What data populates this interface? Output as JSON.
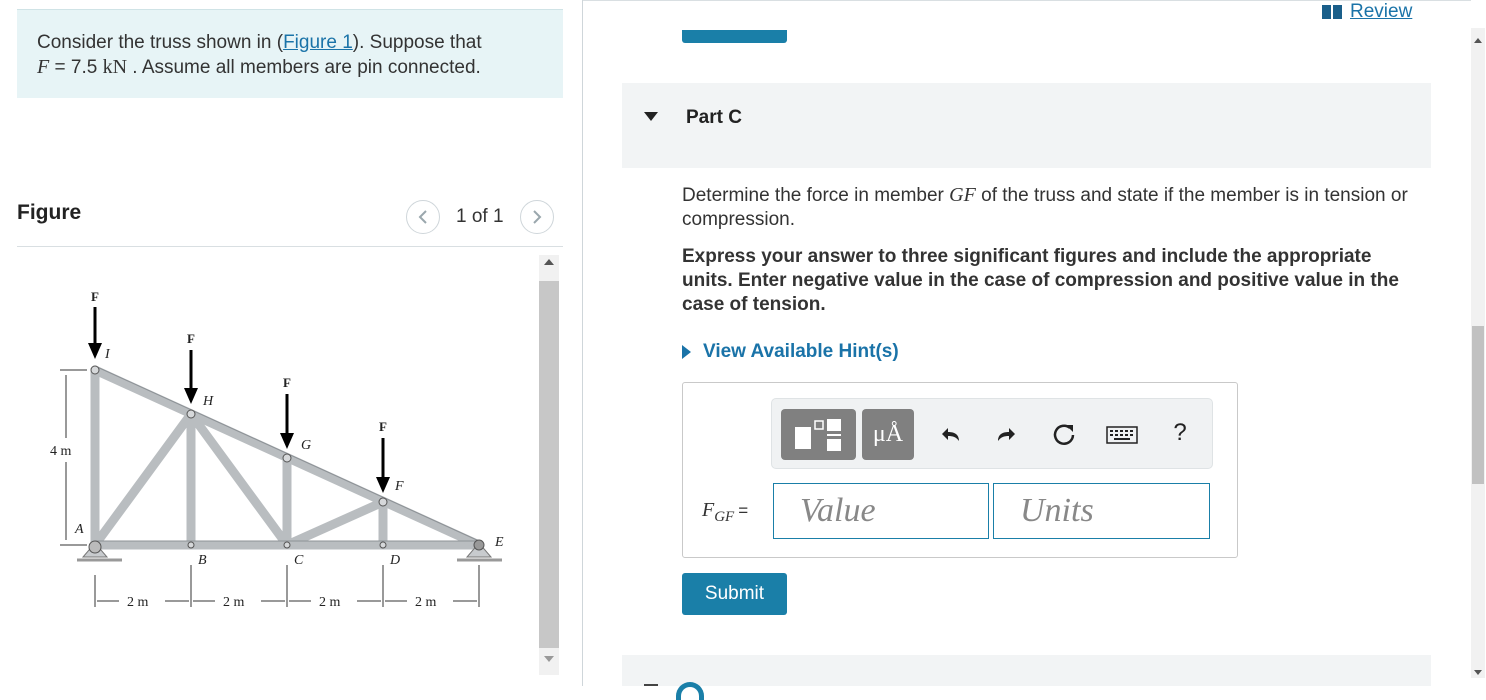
{
  "problem": {
    "text_before_link": "Consider the truss shown in (",
    "link": "Figure 1",
    "text_after_link": "). Suppose that",
    "var_F": "F",
    "equals": " = 7.5 ",
    "unit": "kN",
    "text_end": " . Assume all members are pin connected."
  },
  "figure": {
    "title": "Figure",
    "pager": "1 of 1",
    "load_label": "F",
    "node_labels": [
      "I",
      "H",
      "G",
      "F",
      "A",
      "B",
      "C",
      "D",
      "E"
    ],
    "dim_vertical": "4 m",
    "dim_horizontal": [
      "2 m",
      "2 m",
      "2 m",
      "2 m"
    ]
  },
  "header": {
    "review": "Review"
  },
  "part": {
    "title": "Part C"
  },
  "question": {
    "text_before": "Determine the force in member ",
    "member": "GF",
    "text_after": " of the truss and state if the member is in tension or compression."
  },
  "instruction": "Express your answer to three significant figures and include the appropriate units. Enter negative value in the case of compression and positive value in the case of tension.",
  "hints": {
    "label": "View Available Hint(s)"
  },
  "toolbar": {
    "units_label": "μÅ",
    "help_label": "?"
  },
  "answer": {
    "var_main": "F",
    "var_sub": "GF",
    "equals": "=",
    "value_placeholder": "Value",
    "units_placeholder": "Units"
  },
  "submit": {
    "label": "Submit"
  },
  "colors": {
    "accent": "#1a7fa8",
    "link": "#1a73a8",
    "problem_bg": "#e7f4f6",
    "header_bg": "#f2f4f5"
  }
}
